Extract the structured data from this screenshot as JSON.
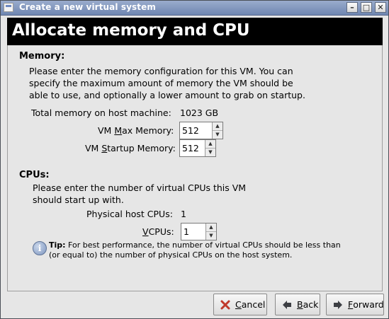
{
  "window": {
    "title": "Create a new virtual system",
    "controls": {
      "minimize": "–",
      "maximize": "□",
      "close": "✕"
    }
  },
  "header": {
    "title": "Allocate memory and CPU"
  },
  "memory": {
    "section_title": "Memory:",
    "description": "Please enter the memory configuration for this VM. You can specify the maximum amount of memory the VM should be able to use, and optionally a lower amount to grab on startup.",
    "total_label": "Total memory on host machine:",
    "total_value": "1023 GB",
    "max_label_pre": "VM ",
    "max_label_mnemonic": "M",
    "max_label_post": "ax Memory:",
    "max_value": "512",
    "startup_label_pre": "VM ",
    "startup_label_mnemonic": "S",
    "startup_label_post": "tartup Memory:",
    "startup_value": "512"
  },
  "cpus": {
    "section_title": "CPUs:",
    "description": "Please enter the number of virtual CPUs this VM should start up with.",
    "physical_label": "Physical host CPUs:",
    "physical_value": "1",
    "vcpus_label_mnemonic": "V",
    "vcpus_label_post": "CPUs:",
    "vcpus_value": "1",
    "tip_bold": "Tip:",
    "tip_text": " For best performance, the number of virtual CPUs should be less than (or equal to) the number of physical CPUs on the host system."
  },
  "buttons": {
    "cancel_mnemonic": "C",
    "cancel_rest": "ancel",
    "back_mnemonic": "B",
    "back_rest": "ack",
    "forward_mnemonic": "F",
    "forward_rest": "orward"
  },
  "icons": {
    "cancel": "cancel-x-icon",
    "back": "back-arrow-icon",
    "forward": "forward-arrow-icon",
    "info": "info-icon"
  },
  "colors": {
    "titlebar": "#7f95bd",
    "header_bg": "#000000",
    "cancel_icon": "#c0392b"
  }
}
